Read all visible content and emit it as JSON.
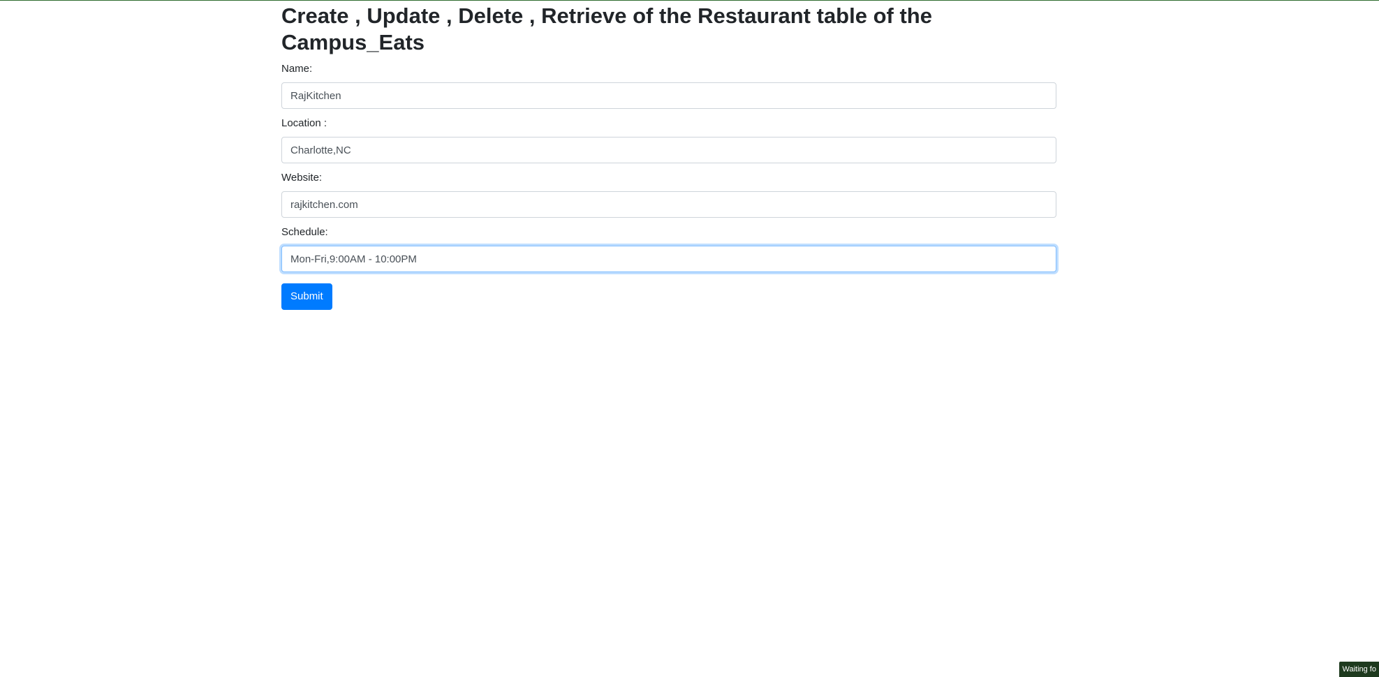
{
  "page": {
    "title": "Create , Update , Delete , Retrieve of the Restaurant table of the Campus_Eats"
  },
  "form": {
    "fields": [
      {
        "label": "Name:",
        "value": "RajKitchen"
      },
      {
        "label": "Location :",
        "value": "Charlotte,NC"
      },
      {
        "label": "Website:",
        "value": "rajkitchen.com"
      },
      {
        "label": "Schedule:",
        "value": "Mon-Fri,9:00AM - 10:00PM"
      }
    ],
    "submit_label": "Submit"
  },
  "status_bar": {
    "text": "Waiting fo"
  },
  "colors": {
    "primary": "#007bff",
    "focus_border": "#80bdff",
    "status_bg": "#1e3a1e"
  }
}
